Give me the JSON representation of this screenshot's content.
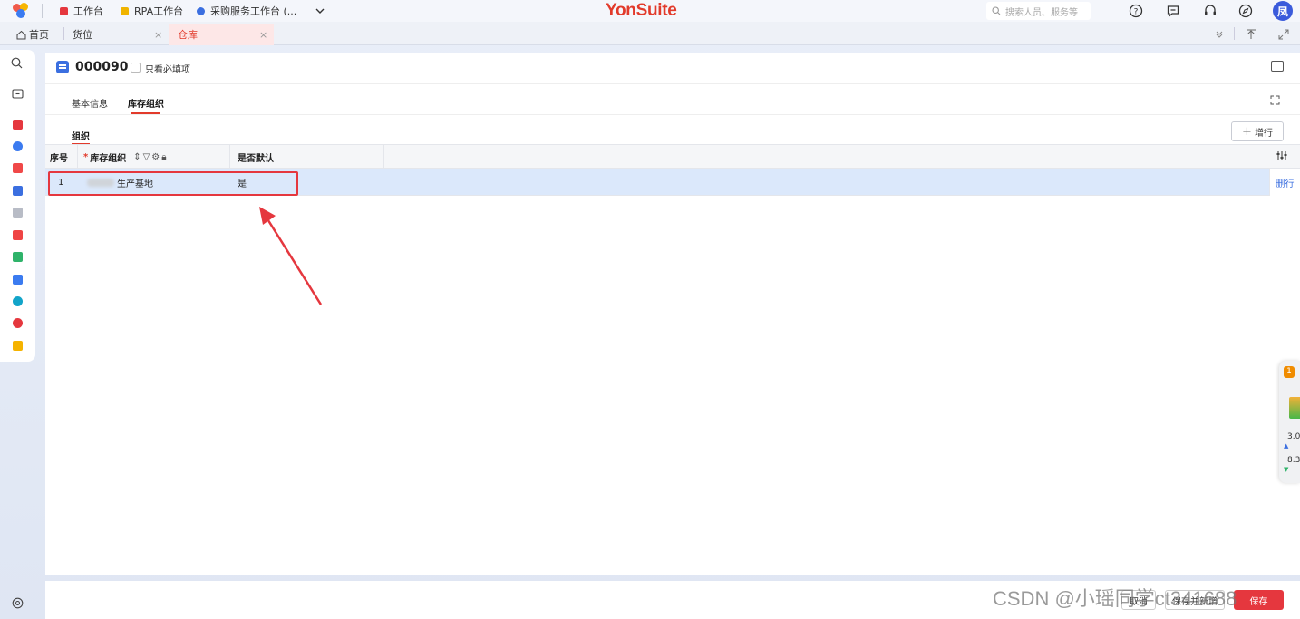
{
  "topbar": {
    "workspaces": [
      {
        "label": "工作台",
        "color": "#e5373e"
      },
      {
        "label": "RPA工作台",
        "color": "#f0b400"
      },
      {
        "label": "采购服务工作台 (...",
        "color": "#3b6fe0"
      }
    ],
    "brand": "YonSuite",
    "search_placeholder": "搜索人员、服务等",
    "avatar_text": "凤"
  },
  "tabs": [
    {
      "label": "首页"
    },
    {
      "label": "货位"
    },
    {
      "label": "仓库"
    }
  ],
  "header": {
    "doc_code": "000090",
    "required_only_label": "只看必填项"
  },
  "subtabs": [
    "基本信息",
    "库存组织"
  ],
  "group": {
    "tab_label": "组织",
    "add_row_label": "增行"
  },
  "grid": {
    "columns": [
      "序号",
      "库存组织",
      "是否默认"
    ],
    "rows": [
      {
        "index": "1",
        "org_suffix": "生产基地",
        "is_default": "是"
      }
    ],
    "delete_row_label": "删行"
  },
  "float_widget": {
    "badge": "1",
    "values": [
      "3.0",
      "8.3"
    ]
  },
  "footer": {
    "cancel_label": "取消",
    "save_new_label": "保存并新增",
    "save_label": "保存"
  },
  "watermark": "CSDN @小瑶同学ct341688",
  "colors": {
    "brand_red": "#e23a2b",
    "accent_blue": "#3b6fe0",
    "row_selected": "#dbe8fb"
  }
}
